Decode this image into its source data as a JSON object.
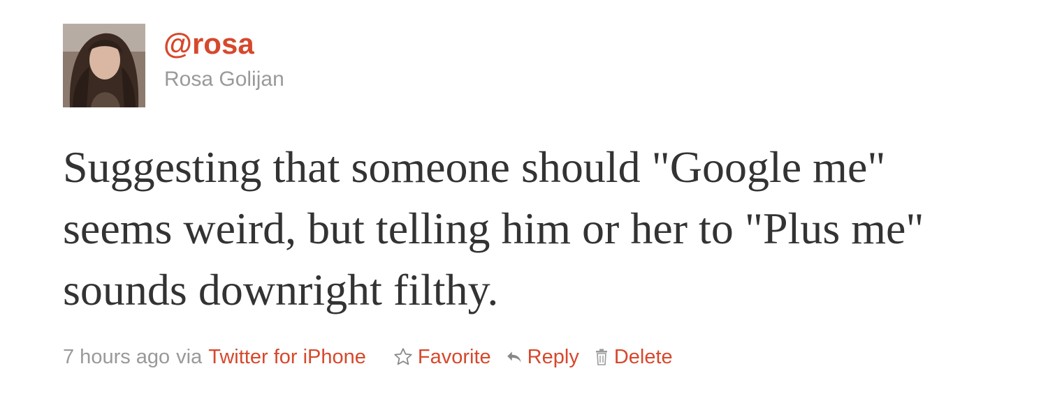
{
  "author": {
    "handle": "@rosa",
    "name": "Rosa Golijan",
    "avatar_icon": "user-avatar-photo"
  },
  "tweet": {
    "text": "Suggesting that someone should \"Google me\" seems weird, but telling him or her to \"Plus me\" sounds downright filthy."
  },
  "meta": {
    "time_ago": "7 hours ago",
    "via_label": "via",
    "source": "Twitter for iPhone"
  },
  "actions": {
    "favorite": {
      "label": "Favorite",
      "icon": "star-outline-icon"
    },
    "reply": {
      "label": "Reply",
      "icon": "reply-arrow-icon"
    },
    "delete": {
      "label": "Delete",
      "icon": "trash-icon"
    }
  },
  "colors": {
    "link": "#d6482c",
    "muted": "#999999",
    "text": "#333333"
  }
}
